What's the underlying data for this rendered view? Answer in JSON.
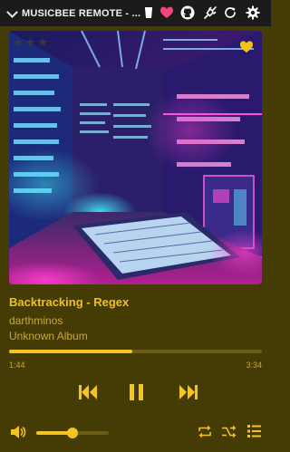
{
  "window": {
    "title": "MUSICBEE REMOTE - ..."
  },
  "track": {
    "title": "Backtracking - Regex",
    "artist": "darthminos",
    "album": "Unknown Album",
    "elapsed": "1:44",
    "total": "3:34",
    "progress_fraction": 0.486
  },
  "volume": {
    "level_fraction": 0.5
  },
  "rating": {
    "stars": 0,
    "max": 5,
    "loved": true
  },
  "colors": {
    "accent": "#f5c41e",
    "background": "#443b05",
    "titlebar": "#1b1b1b",
    "heart": "#f0487a"
  },
  "icons": {
    "titlebar": [
      "chevron-down-icon",
      "cup-icon",
      "heart-icon",
      "github-icon",
      "plug-icon",
      "refresh-icon",
      "gear-icon"
    ],
    "controls": [
      "previous-icon",
      "pause-icon",
      "next-icon"
    ],
    "bottom": [
      "volume-icon",
      "repeat-icon",
      "shuffle-icon",
      "playlist-icon"
    ]
  }
}
